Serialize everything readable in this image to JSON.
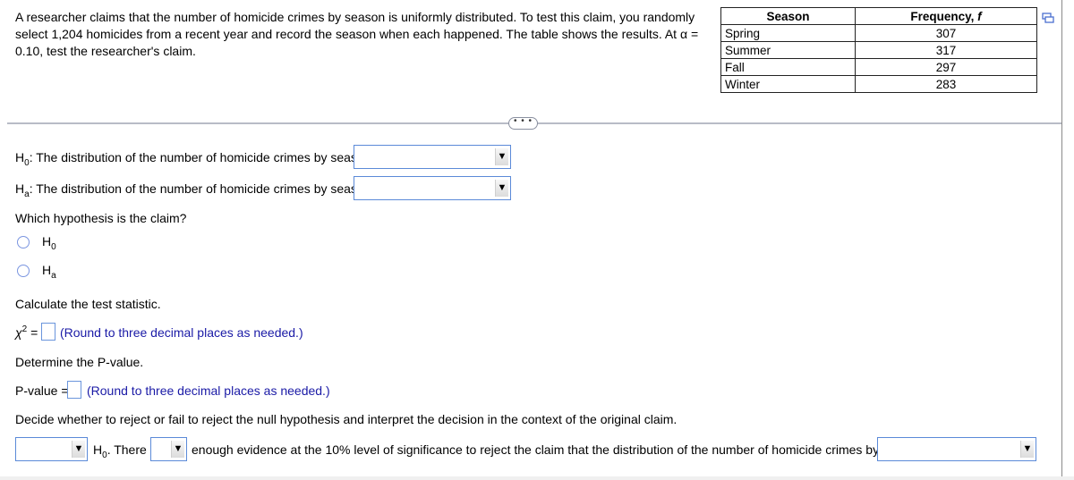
{
  "problem": {
    "intro": "A researcher claims that the number of homicide crimes by season is uniformly distributed. To test this claim, you randomly select 1,204 homicides from a recent year and record the season when each happened. The table shows the results. At α = 0.10, test the researcher's claim."
  },
  "table": {
    "headers": [
      "Season",
      "Frequency, f"
    ],
    "rows": [
      {
        "season": "Spring",
        "frequency": "307"
      },
      {
        "season": "Summer",
        "frequency": "317"
      },
      {
        "season": "Fall",
        "frequency": "297"
      },
      {
        "season": "Winter",
        "frequency": "283"
      }
    ]
  },
  "more_button": "• • •",
  "hypotheses": {
    "h0_symbol": "H",
    "h0_sub": "0",
    "h0_text": ": The distribution of the number of homicide crimes by season",
    "ha_symbol": "H",
    "ha_sub": "a",
    "ha_text": ": The distribution of the number of homicide crimes by season",
    "h0_select_value": "",
    "ha_select_value": ""
  },
  "claim_question": {
    "prompt": "Which hypothesis is the claim?",
    "options": [
      {
        "symbol": "H",
        "sub": "0"
      },
      {
        "symbol": "H",
        "sub": "a"
      }
    ]
  },
  "test_statistic": {
    "prompt": "Calculate the test statistic.",
    "symbol": "χ",
    "sup": "2",
    "equals": " =",
    "value": "",
    "hint": "(Round to three decimal places as needed.)"
  },
  "p_value": {
    "prompt": "Determine the P-value.",
    "label": "P-value =",
    "value": "",
    "hint": "(Round to three decimal places as needed.)"
  },
  "decision": {
    "prompt": "Decide whether to reject or fail to reject the null hypothesis and interpret the decision in the context of the original claim.",
    "h_symbol": "H",
    "h_sub": "0",
    "after_h": ". There",
    "middle_text": "enough evidence at the 10% level of significance to reject the claim that the distribution of the number of homicide crimes by season",
    "select1_value": "",
    "select2_value": "",
    "select3_value": ""
  },
  "icons": {
    "dropdown_arrow": "▼"
  }
}
